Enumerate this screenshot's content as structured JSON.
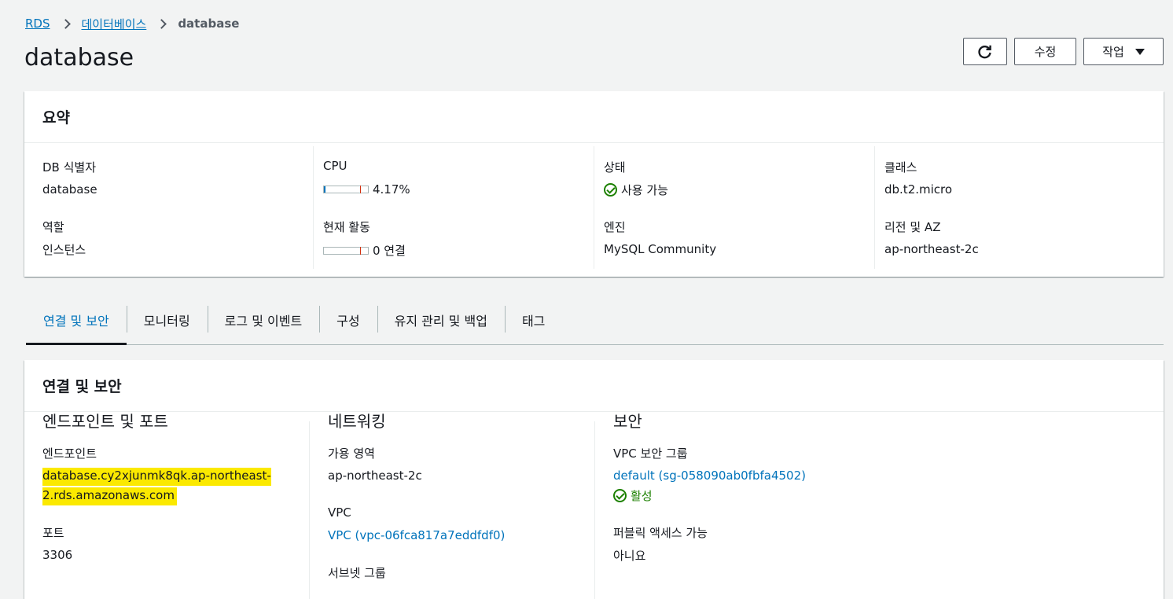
{
  "breadcrumb": {
    "rds": "RDS",
    "databases": "데이터베이스",
    "current": "database"
  },
  "page": {
    "title": "database"
  },
  "header_buttons": {
    "refresh_icon": "refresh-icon",
    "edit": "수정",
    "actions": "작업"
  },
  "summary": {
    "title": "요약",
    "db_id_label": "DB 식별자",
    "db_id_value": "database",
    "role_label": "역할",
    "role_value": "인스턴스",
    "cpu_label": "CPU",
    "cpu_value": "4.17%",
    "cpu_percent": 4.17,
    "activity_label": "현재 활동",
    "activity_value": "0 연결",
    "status_label": "상태",
    "status_value": "사용 가능",
    "engine_label": "엔진",
    "engine_value": "MySQL Community",
    "class_label": "클래스",
    "class_value": "db.t2.micro",
    "region_label": "리전 및 AZ",
    "region_value": "ap-northeast-2c"
  },
  "tabs": [
    {
      "label": "연결 및 보안",
      "active": true
    },
    {
      "label": "모니터링",
      "active": false
    },
    {
      "label": "로그 및 이벤트",
      "active": false
    },
    {
      "label": "구성",
      "active": false
    },
    {
      "label": "유지 관리 및 백업",
      "active": false
    },
    {
      "label": "태그",
      "active": false
    }
  ],
  "connectivity": {
    "title": "연결 및 보안",
    "endpoint_section": "엔드포인트 및 포트",
    "endpoint_label": "엔드포인트",
    "endpoint_line1": "database.cy2xjunmk8qk.ap-northeast-",
    "endpoint_line2": "2.rds.amazonaws.com",
    "port_label": "포트",
    "port_value": "3306",
    "network_section": "네트워킹",
    "az_label": "가용 영역",
    "az_value": "ap-northeast-2c",
    "vpc_label": "VPC",
    "vpc_value": "VPC (vpc-06fca817a7eddfdf0)",
    "subnet_label": "서브넷 그룹",
    "security_section": "보안",
    "sg_label": "VPC 보안 그룹",
    "sg_value": "default (sg-058090ab0fbfa4502)",
    "sg_status": "활성",
    "public_label": "퍼블릭 액세스 가능",
    "public_value": "아니요"
  },
  "colors": {
    "link": "#0073bb",
    "success": "#1d8102",
    "highlight": "#fbe900"
  }
}
